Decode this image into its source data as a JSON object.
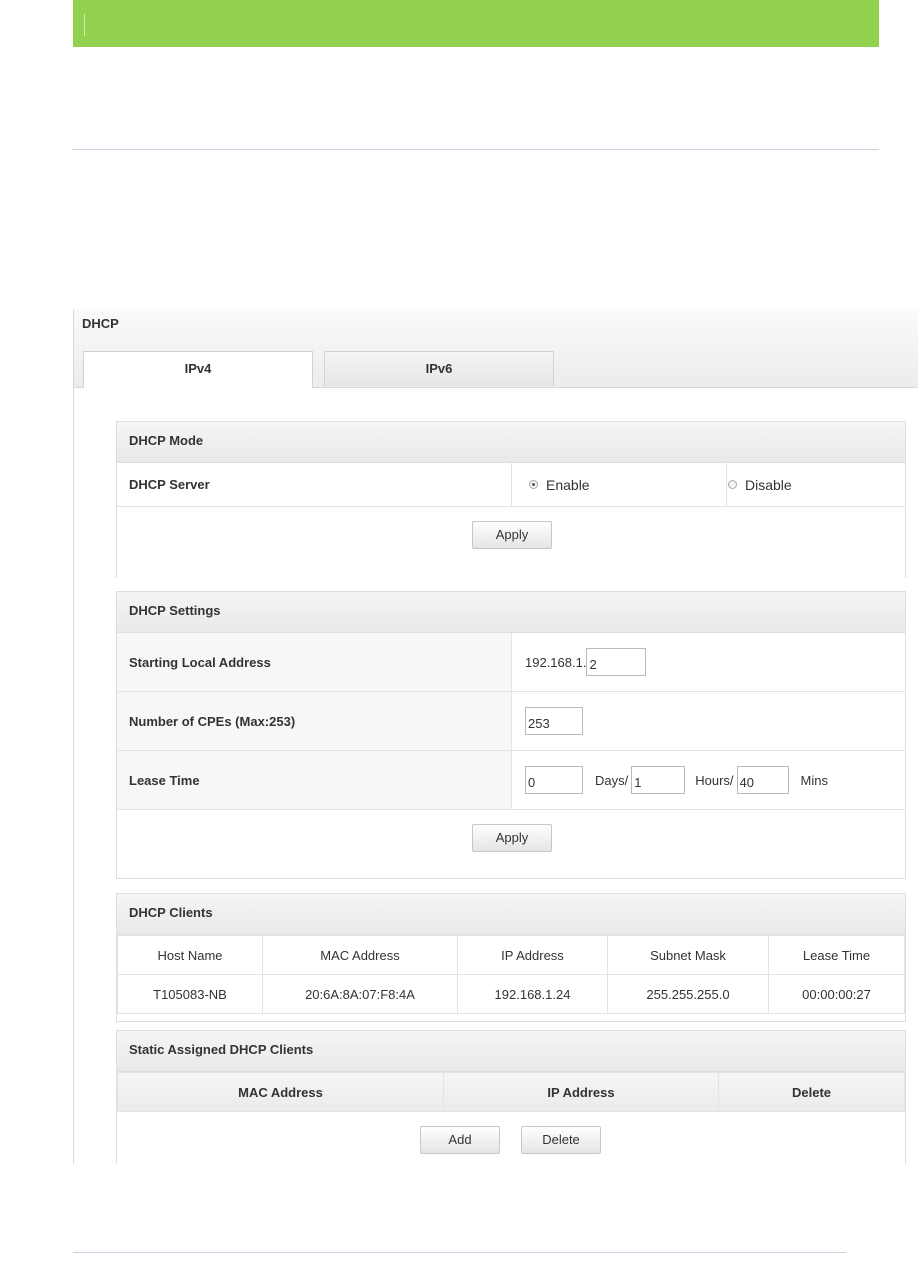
{
  "window": {
    "title": "DHCP"
  },
  "tabs": [
    {
      "label": "IPv4",
      "active": true
    },
    {
      "label": "IPv6",
      "active": false
    }
  ],
  "dhcp_mode": {
    "title": "DHCP Mode",
    "server_label": "DHCP Server",
    "options": [
      {
        "label": "Enable",
        "selected": true
      },
      {
        "label": "Disable",
        "selected": false
      }
    ],
    "apply_label": "Apply"
  },
  "dhcp_settings": {
    "title": "DHCP Settings",
    "starting_label": "Starting Local Address",
    "starting_prefix": "192.168.1.",
    "starting_value": "2",
    "cpe_label": "Number of CPEs (Max:253)",
    "cpe_value": "253",
    "lease_label": "Lease Time",
    "lease_days": "0",
    "days_unit": "Days/",
    "lease_hours": "1",
    "hours_unit": "Hours/",
    "lease_mins": "40",
    "mins_unit": "Mins",
    "apply_label": "Apply"
  },
  "dhcp_clients": {
    "title": "DHCP Clients",
    "columns": [
      "Host Name",
      "MAC Address",
      "IP Address",
      "Subnet Mask",
      "Lease Time"
    ],
    "rows": [
      [
        "T105083-NB",
        "20:6A:8A:07:F8:4A",
        "192.168.1.24",
        "255.255.255.0",
        "00:00:00:27"
      ]
    ]
  },
  "static_clients": {
    "title": "Static Assigned DHCP Clients",
    "columns": [
      "MAC Address",
      "IP Address",
      "Delete"
    ],
    "add_label": "Add",
    "delete_label": "Delete"
  },
  "colors": {
    "top_bar": "#92d050",
    "divider": "#c5d3e0"
  }
}
